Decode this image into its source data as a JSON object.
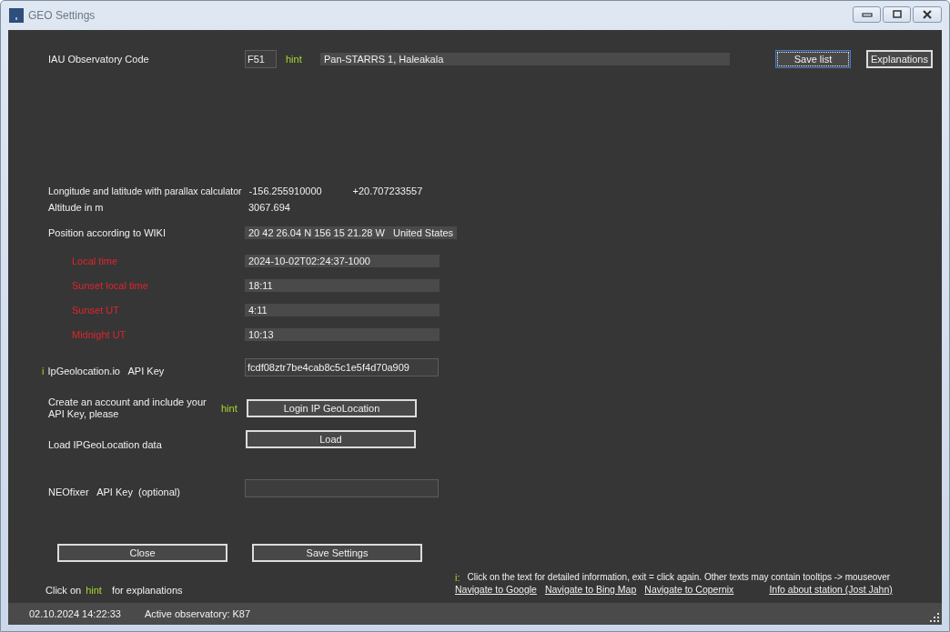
{
  "window": {
    "title": "GEO Settings"
  },
  "observatory": {
    "label": "IAU Observatory Code",
    "code": "F51",
    "hint": "hint",
    "name": "Pan-STARRS 1, Haleakala"
  },
  "top_buttons": [
    {
      "label": "Save list",
      "focused": true
    },
    {
      "label": "Explanations",
      "focused": false
    }
  ],
  "coordinates": {
    "label": "Longitude and latitude with parallax calculator",
    "longitude": "-156.255910000",
    "latitude": "+20.707233557"
  },
  "altitude": {
    "label": "Altitude in m",
    "value": "3067.694"
  },
  "wiki": {
    "label": "Position according to WIKI",
    "value": "20 42 26.04 N 156 15 21.28 W",
    "country": "United States"
  },
  "times": [
    {
      "label": "Local time",
      "value": "2024-10-02T02:24:37-1000"
    },
    {
      "label": "Sunset local time",
      "value": "18:11"
    },
    {
      "label": "Sunset UT",
      "value": "4:11"
    },
    {
      "label": "Midnight UT",
      "value": "10:13"
    }
  ],
  "ipgeo": {
    "info": "i",
    "label": "IpGeolocation.io   API Key",
    "value": "fcdf08ztr7be4cab8c5c1e5f4d70a909"
  },
  "account": {
    "label": "Create an account and include your API Key, please",
    "hint": "hint",
    "button": "Login IP GeoLocation"
  },
  "load": {
    "label": "Load IPGeoLocation data",
    "button": "Load"
  },
  "neofixer": {
    "label": "NEOfixer   API Key  (optional)"
  },
  "bottom_buttons": [
    "Close",
    "Save Settings"
  ],
  "hint_line": {
    "before": "Click on",
    "hint": "hint",
    "after": "for explanations"
  },
  "info": {
    "marker": "i:",
    "text": "Click on the text for detailed information, exit = click again. Other texts may contain tooltips -> mouseover"
  },
  "links": [
    "Navigate to Google",
    "Navigate to Bing Map",
    "Navigate to Copernix",
    "Info about station (Jost Jahn)"
  ],
  "status_bar": {
    "datetime": "02.10.2024 14:22:33",
    "observatory": "Active observatory: K87"
  }
}
